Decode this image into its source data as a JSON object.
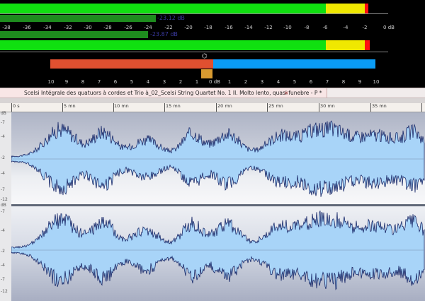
{
  "meters": {
    "upper_peak_label": "-23.12 dB",
    "lower_peak_label": "-23.87 dB",
    "db_scale": [
      "-38",
      "-36",
      "-34",
      "-32",
      "-30",
      "-28",
      "-26",
      "-24",
      "-22",
      "-20",
      "-18",
      "-16",
      "-14",
      "-12",
      "-10",
      "-8",
      "-6",
      "-4",
      "-2",
      "0 dB"
    ],
    "phase_scale": [
      "10",
      "9",
      "8",
      "7",
      "6",
      "5",
      "4",
      "3",
      "2",
      "1",
      "0 dB",
      "1",
      "2",
      "3",
      "4",
      "5",
      "6",
      "7",
      "8",
      "9",
      "10"
    ],
    "colors": {
      "green": "#10e010",
      "dark_green": "#148a14",
      "yellow": "#f0e800",
      "red": "#ff1010",
      "orange": "#e05030",
      "blue": "#0a9cf5"
    }
  },
  "document": {
    "tab_title": "Scelsi   Intégrale des quatuors à cordes et Trio à_02_Scelsi  String Quartet No. 1  II. Molto lento, quasi funebre - P *",
    "close_symbol": "×"
  },
  "timeline": {
    "labels": [
      "0 s",
      "5 mn",
      "10 mn",
      "15 mn",
      "20 mn",
      "25 mn",
      "30 mn",
      "35 mn"
    ]
  },
  "axis": {
    "upper": [
      "dB",
      "-7",
      "-4",
      "-2",
      "-4",
      "-7"
    ],
    "lower": [
      "dB",
      "-7",
      "-4",
      "-2",
      "-4",
      "-7",
      "-12"
    ],
    "upper_extra": [
      "-12",
      "dB"
    ],
    "lower_extra": [
      "-12",
      "dB"
    ]
  }
}
